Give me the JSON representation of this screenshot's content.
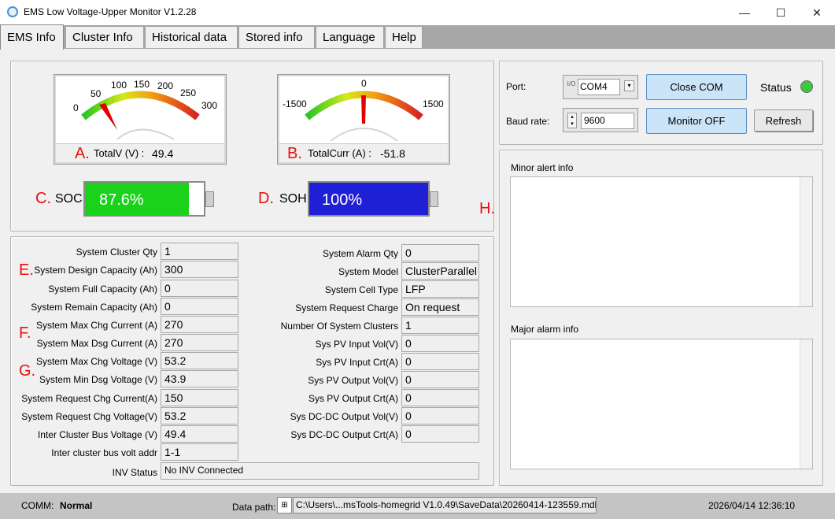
{
  "window": {
    "title": "EMS Low Voltage-Upper Monitor V1.2.28",
    "minimize": "—",
    "maximize": "☐",
    "close": "✕"
  },
  "tabs": [
    "EMS Info",
    "Cluster Info",
    "Historical data",
    "Stored info",
    "Language",
    "Help"
  ],
  "active_tab": "EMS Info",
  "gauges": {
    "voltage": {
      "ticks": [
        "0",
        "50",
        "100",
        "150",
        "200",
        "250",
        "300"
      ],
      "label": "TotalV (V) :",
      "value": "49.4",
      "marker": "A."
    },
    "current": {
      "ticks": [
        "-1500",
        "0",
        "1500"
      ],
      "label": "TotalCurr (A) :",
      "value": "-51.8",
      "marker": "B."
    }
  },
  "soc": {
    "marker": "C.",
    "label": "SOC",
    "value": "87.6%",
    "fill_percent": 87.6,
    "color": "#19d219"
  },
  "soh": {
    "marker": "D.",
    "label": "SOH",
    "value": "100%",
    "fill_percent": 100,
    "color": "#1f1fd6"
  },
  "markers": {
    "E": "E.",
    "F": "F.",
    "G": "G.",
    "H": "H."
  },
  "left_fields": [
    {
      "label": "System Cluster Qty",
      "value": "1"
    },
    {
      "label": "System Design Capacity (Ah)",
      "value": "300"
    },
    {
      "label": "System Full Capacity (Ah)",
      "value": "0"
    },
    {
      "label": "System Remain Capacity (Ah)",
      "value": "0"
    },
    {
      "label": "System Max Chg Current (A)",
      "value": "270"
    },
    {
      "label": "System Max Dsg Current (A)",
      "value": "270"
    },
    {
      "label": "System Max Chg Voltage (V)",
      "value": "53.2"
    },
    {
      "label": "System Min Dsg Voltage (V)",
      "value": "43.9"
    },
    {
      "label": "System Request Chg Current(A)",
      "value": "150"
    },
    {
      "label": "System Request Chg Voltage(V)",
      "value": "53.2"
    },
    {
      "label": "Inter Cluster Bus Voltage  (V)",
      "value": "49.4"
    },
    {
      "label": "Inter cluster bus volt addr",
      "value": "1-1"
    }
  ],
  "right_fields": [
    {
      "label": "System Alarm Qty",
      "value": "0"
    },
    {
      "label": "System Model",
      "value": "ClusterParallel"
    },
    {
      "label": "System Cell Type",
      "value": "LFP"
    },
    {
      "label": "System Request Charge",
      "value": "On request"
    },
    {
      "label": "Number Of System Clusters",
      "value": "1"
    },
    {
      "label": "Sys PV Input Vol(V)",
      "value": "0"
    },
    {
      "label": "Sys PV Input Crt(A)",
      "value": "0"
    },
    {
      "label": "Sys PV Output Vol(V)",
      "value": "0"
    },
    {
      "label": "Sys PV Output Crt(A)",
      "value": "0"
    },
    {
      "label": "Sys DC-DC Output Vol(V)",
      "value": "0"
    },
    {
      "label": "Sys DC-DC Output Crt(A)",
      "value": "0"
    }
  ],
  "inv_status": {
    "label": "INV Status",
    "value": "No INV Connected"
  },
  "connection": {
    "port_label": "Port:",
    "port_value": "COM4",
    "port_prefix": "I/O",
    "baud_label": "Baud rate:",
    "baud_value": "9600",
    "close_com": "Close COM",
    "monitor_off": "Monitor OFF",
    "refresh": "Refresh",
    "status_label": "Status",
    "status_color": "#3cc83c"
  },
  "alerts": {
    "minor_title": "Minor alert info",
    "major_title": "Major alarm info"
  },
  "statusbar": {
    "comm_label": "COMM:",
    "comm_value": "Normal",
    "data_path_label": "Data path:",
    "data_path": "C:\\Users\\...msTools-homegrid V1.0.49\\SaveData\\20260414-123559.mdb",
    "datetime": "2026/04/14 12:36:10"
  }
}
